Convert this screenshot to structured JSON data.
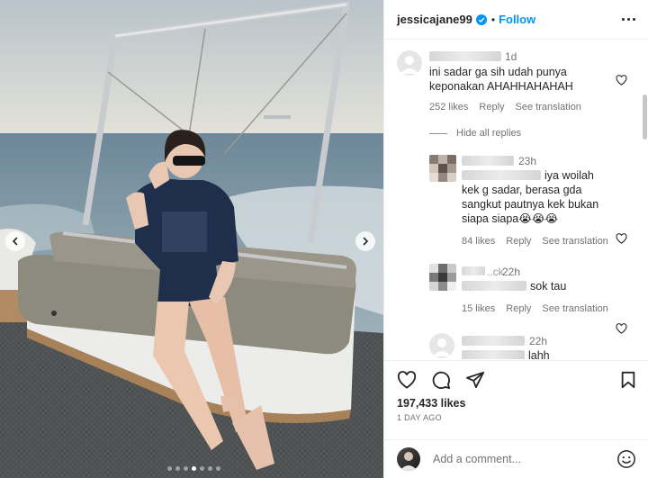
{
  "post": {
    "username": "jessicajane99",
    "separator": "•",
    "follow_label": "Follow",
    "photo_count": 7,
    "photo_active_index": 3
  },
  "comments": [
    {
      "time": "1d",
      "text_lines": [
        "ini sadar ga sih udah punya",
        "keponakan AHAHHAHAHAH"
      ],
      "likes": "252 likes",
      "reply": "Reply",
      "translate": "See translation"
    }
  ],
  "hide_replies_label": "Hide all replies",
  "replies": [
    {
      "time": "23h",
      "text_lines": [
        "iya woilah",
        "kek g sadar, berasa gda",
        "sangkut pautnya kek bukan",
        "siapa siapa😭😭😭"
      ],
      "likes": "84 likes",
      "reply": "Reply",
      "translate": "See translation"
    },
    {
      "name_fragment": "..ck",
      "time": "22h",
      "text": "sok tau",
      "likes": "15 likes",
      "reply": "Reply",
      "translate": "See translation"
    },
    {
      "time": "22h",
      "text": "lahh"
    }
  ],
  "actions": {
    "likes": "197,433 likes",
    "posted_ago": "1 DAY AGO"
  },
  "composer": {
    "placeholder": "Add a comment..."
  },
  "colors": {
    "accent": "#0095f6",
    "text": "#262626",
    "secondary": "#737373"
  },
  "icons": [
    "verified-badge-icon",
    "more-options-icon",
    "heart-icon",
    "comment-icon",
    "share-icon",
    "bookmark-icon",
    "emoji-icon",
    "chevron-left-icon",
    "chevron-right-icon"
  ]
}
